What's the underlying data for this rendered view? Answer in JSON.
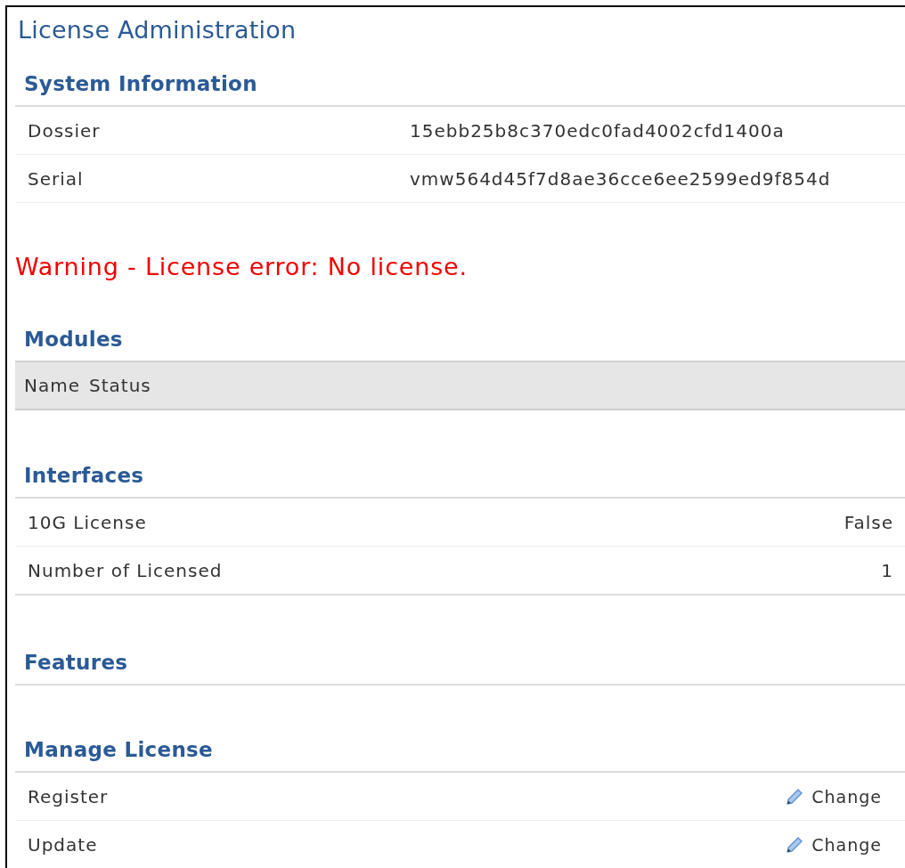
{
  "page": {
    "title": "License Administration"
  },
  "blocks": [
    {
      "kind": "info",
      "heading": "System Information",
      "rows": [
        {
          "label": "Dossier",
          "value": "15ebb25b8c370edc0fad4002cfd1400a"
        },
        {
          "label": "Serial",
          "value": "vmw564d45f7d8ae36cce6ee2599ed9f854d"
        }
      ]
    },
    {
      "kind": "warning",
      "text": "Warning - License error: No license."
    },
    {
      "kind": "grid",
      "heading": "Modules",
      "columns": [
        "Name",
        "Status"
      ]
    },
    {
      "kind": "counts",
      "heading": "Interfaces",
      "rows": [
        {
          "label": "10G License",
          "value": "False"
        },
        {
          "label": "Number of Licensed",
          "value": "1"
        }
      ]
    },
    {
      "kind": "counts",
      "heading": "Features"
    },
    {
      "kind": "actions",
      "heading": "Manage License",
      "rows": [
        {
          "label": "Register",
          "action": "Change"
        },
        {
          "label": "Update",
          "action": "Change"
        }
      ]
    }
  ]
}
